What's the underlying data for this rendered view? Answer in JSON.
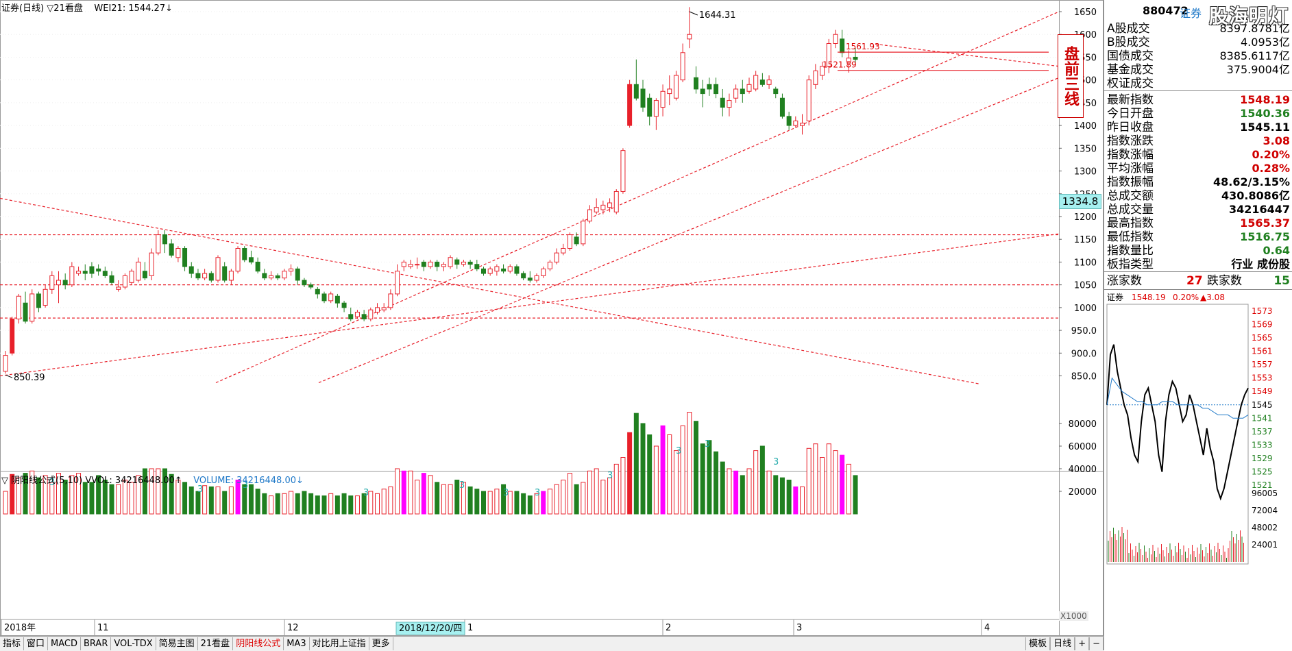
{
  "main_header": {
    "title": "证券(日线)",
    "view": "▽21看盘",
    "indicator": "WEI21: 1544.27↓"
  },
  "volume_header": {
    "formula": "▽ 阴阳线公式(5,10)",
    "vvol": "VVOL: 34216448.00↑",
    "volume": "VOLUME: 34216448.00↓"
  },
  "annotations": {
    "high_label": "1644.31",
    "low_label": "850.39",
    "level1": "1561.93",
    "level2": "1521.89",
    "box_text": "盘前三线",
    "date_cursor": "2018/12/20/四",
    "volume_unit": "X1000",
    "current_price_tag": "1334.8"
  },
  "price_axis": [
    "1650",
    "1600",
    "1550",
    "1500",
    "1450",
    "1400",
    "1350",
    "1300",
    "1250",
    "1200",
    "1150",
    "1100",
    "1050",
    "1000",
    "950.0",
    "900.0",
    "850.0"
  ],
  "volume_axis": [
    "80000",
    "60000",
    "40000",
    "20000"
  ],
  "date_axis": [
    "2018年",
    "11",
    "12",
    "1",
    "2",
    "3",
    "4"
  ],
  "tabs": [
    {
      "label": "指标",
      "active": false
    },
    {
      "label": "窗口",
      "active": false
    },
    {
      "label": "MACD",
      "active": false
    },
    {
      "label": "BRAR",
      "active": false
    },
    {
      "label": "VOL-TDX",
      "active": false
    },
    {
      "label": "简易主图",
      "active": false
    },
    {
      "label": "21看盘",
      "active": false
    },
    {
      "label": "阴阳线公式",
      "active": true
    },
    {
      "label": "MA3",
      "active": false
    },
    {
      "label": "对比用上证指",
      "active": false
    },
    {
      "label": "更多",
      "active": false
    }
  ],
  "tabs_right": [
    "模板",
    "日线",
    "+",
    "−"
  ],
  "panel": {
    "code": "880472",
    "name": "证券",
    "watermark": "股海明灯",
    "turnover_rows": [
      {
        "label": "A股成交",
        "value": "8397.8781亿"
      },
      {
        "label": "B股成交",
        "value": "4.0953亿"
      },
      {
        "label": "国债成交",
        "value": "8385.6117亿"
      },
      {
        "label": "基金成交",
        "value": "375.9004亿"
      },
      {
        "label": "权证成交",
        "value": ""
      }
    ],
    "index_rows": [
      {
        "label": "最新指数",
        "value": "1548.19",
        "color": "#d00000"
      },
      {
        "label": "今日开盘",
        "value": "1540.36",
        "color": "#208020"
      },
      {
        "label": "昨日收盘",
        "value": "1545.11",
        "color": "#000000"
      },
      {
        "label": "指数涨跌",
        "value": "3.08",
        "color": "#d00000"
      },
      {
        "label": "指数涨幅",
        "value": "0.20%",
        "color": "#d00000"
      },
      {
        "label": "平均涨幅",
        "value": "0.28%",
        "color": "#d00000"
      },
      {
        "label": "指数振幅",
        "value": "48.62/3.15%",
        "color": "#000000"
      },
      {
        "label": "总成交额",
        "value": "430.8086亿",
        "color": "#000000"
      },
      {
        "label": "总成交量",
        "value": "34216447",
        "color": "#000000"
      },
      {
        "label": "最高指数",
        "value": "1565.37",
        "color": "#d00000"
      },
      {
        "label": "最低指数",
        "value": "1516.75",
        "color": "#208020"
      },
      {
        "label": "指数量比",
        "value": "0.64",
        "color": "#208020"
      },
      {
        "label": "板指类型",
        "value": "行业 成份股",
        "color": "#000000"
      }
    ],
    "breadth": {
      "up_label": "涨家数",
      "up": "27",
      "down_label": "跌家数",
      "down": "15"
    },
    "mini_header": {
      "name": "证券",
      "price": "1548.19",
      "pct": "0.20%",
      "change": "▲3.08"
    },
    "mini_price_axis": [
      "1573",
      "1569",
      "1565",
      "1561",
      "1557",
      "1553",
      "1549",
      "1545",
      "1541",
      "1537",
      "1533",
      "1529",
      "1525",
      "1521"
    ],
    "mini_vol_axis": [
      "96005",
      "72004",
      "48002",
      "24001"
    ]
  },
  "colors": {
    "up": "#e8202a",
    "down": "#208020",
    "special": "#ff00ff",
    "trend": "#e8202a"
  }
}
